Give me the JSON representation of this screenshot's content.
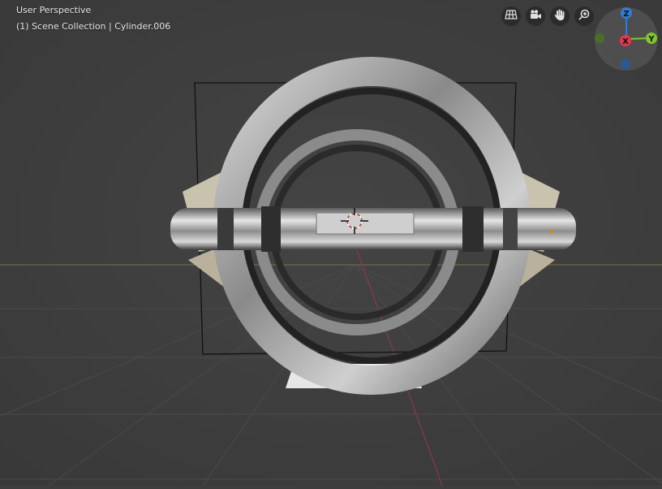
{
  "viewport": {
    "view_name": "User Perspective",
    "collection_label": "(1) Scene Collection | Cylinder.006",
    "colors": {
      "background": "#3d3d3d",
      "grid": "#484848",
      "horizon": "#6e6b3c",
      "y_axis_line": "#8a3a44",
      "metal": "#b8b8b8",
      "outline": "#111111"
    }
  },
  "nav_buttons": [
    {
      "icon": "grid-icon",
      "label": "Toggle Camera View Grid"
    },
    {
      "icon": "camera-icon",
      "label": "Toggle the camera view"
    },
    {
      "icon": "hand-icon",
      "label": "Move the view"
    },
    {
      "icon": "zoom-icon",
      "label": "Zoom in/out in the view"
    }
  ],
  "gizmo": {
    "axes": [
      {
        "label": "Z",
        "color": "#2f7dd6"
      },
      {
        "label": "Y",
        "color": "#7fc72a"
      },
      {
        "label": "X",
        "color": "#e8354a"
      }
    ]
  }
}
